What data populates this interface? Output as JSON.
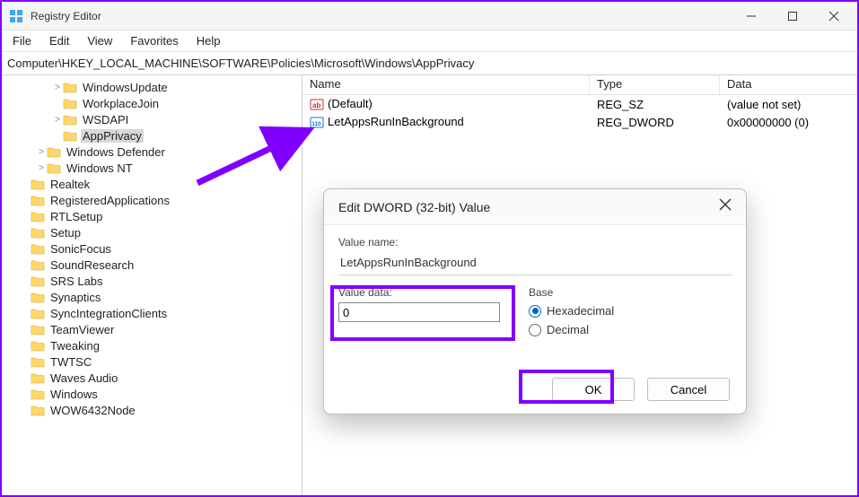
{
  "window": {
    "title": "Registry Editor"
  },
  "menu": {
    "file": "File",
    "edit": "Edit",
    "view": "View",
    "favorites": "Favorites",
    "help": "Help"
  },
  "address": "Computer\\HKEY_LOCAL_MACHINE\\SOFTWARE\\Policies\\Microsoft\\Windows\\AppPrivacy",
  "tree": {
    "items": [
      {
        "indent": 3,
        "twisty": ">",
        "label": "WindowsUpdate"
      },
      {
        "indent": 3,
        "twisty": "",
        "label": "WorkplaceJoin"
      },
      {
        "indent": 3,
        "twisty": ">",
        "label": "WSDAPI"
      },
      {
        "indent": 3,
        "twisty": "",
        "label": "AppPrivacy",
        "selected": true
      },
      {
        "indent": 2,
        "twisty": ">",
        "label": "Windows Defender"
      },
      {
        "indent": 2,
        "twisty": ">",
        "label": "Windows NT"
      },
      {
        "indent": 1,
        "twisty": "",
        "label": "Realtek"
      },
      {
        "indent": 1,
        "twisty": "",
        "label": "RegisteredApplications"
      },
      {
        "indent": 1,
        "twisty": "",
        "label": "RTLSetup"
      },
      {
        "indent": 1,
        "twisty": "",
        "label": "Setup"
      },
      {
        "indent": 1,
        "twisty": "",
        "label": "SonicFocus"
      },
      {
        "indent": 1,
        "twisty": "",
        "label": "SoundResearch"
      },
      {
        "indent": 1,
        "twisty": "",
        "label": "SRS Labs"
      },
      {
        "indent": 1,
        "twisty": "",
        "label": "Synaptics"
      },
      {
        "indent": 1,
        "twisty": "",
        "label": "SyncIntegrationClients"
      },
      {
        "indent": 1,
        "twisty": "",
        "label": "TeamViewer"
      },
      {
        "indent": 1,
        "twisty": "",
        "label": "Tweaking"
      },
      {
        "indent": 1,
        "twisty": "",
        "label": "TWTSC"
      },
      {
        "indent": 1,
        "twisty": "",
        "label": "Waves Audio"
      },
      {
        "indent": 1,
        "twisty": "",
        "label": "Windows"
      },
      {
        "indent": 1,
        "twisty": "",
        "label": "WOW6432Node"
      }
    ]
  },
  "list": {
    "columns": {
      "name": "Name",
      "type": "Type",
      "data": "Data"
    },
    "rows": [
      {
        "icon": "sz",
        "name": "(Default)",
        "type": "REG_SZ",
        "data": "(value not set)"
      },
      {
        "icon": "dword",
        "name": "LetAppsRunInBackground",
        "type": "REG_DWORD",
        "data": "0x00000000 (0)"
      }
    ]
  },
  "dialog": {
    "title": "Edit DWORD (32-bit) Value",
    "value_name_label": "Value name:",
    "value_name": "LetAppsRunInBackground",
    "value_data_label": "Value data:",
    "value_data": "0",
    "base_label": "Base",
    "hex_label": "Hexadecimal",
    "dec_label": "Decimal",
    "ok": "OK",
    "cancel": "Cancel"
  }
}
